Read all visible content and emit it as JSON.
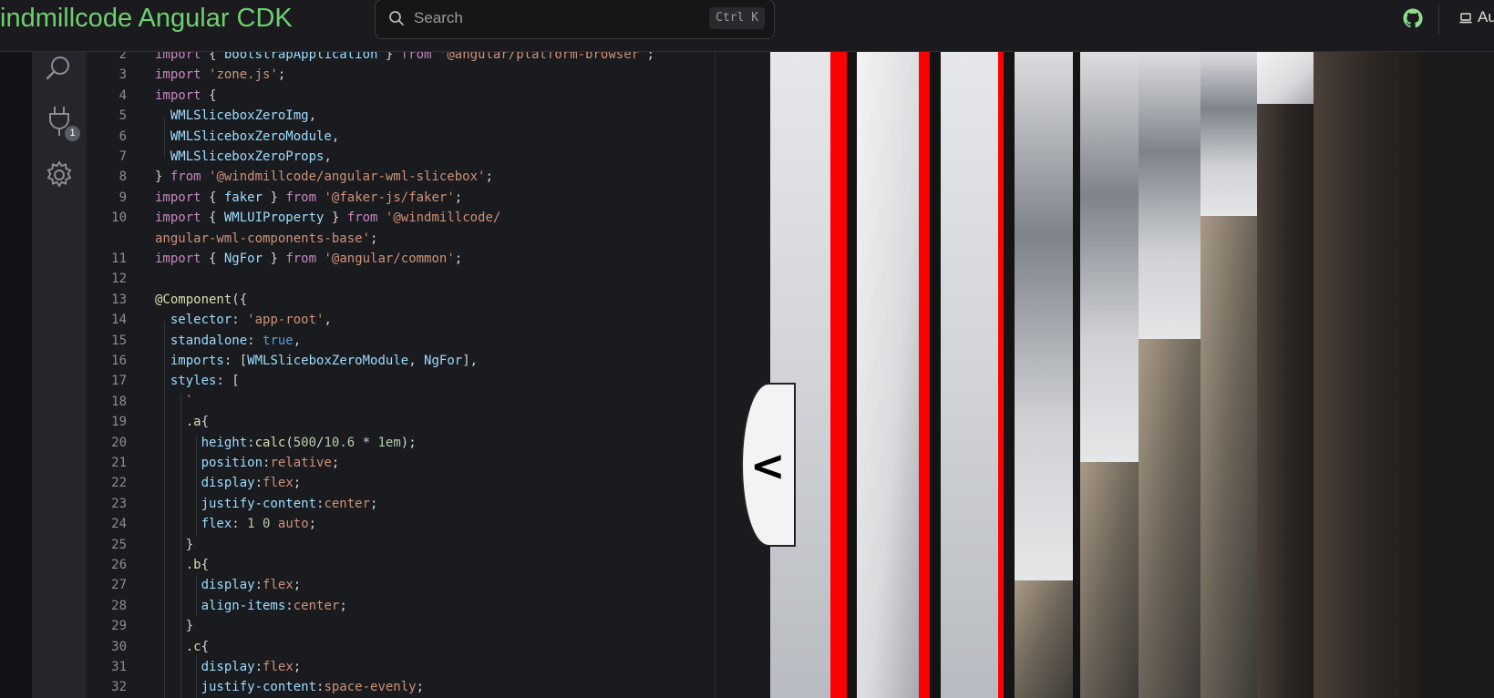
{
  "header": {
    "brand": "indmillcode Angular CDK",
    "search_placeholder": "Search",
    "search_shortcut": "Ctrl K",
    "auth_label": "Au"
  },
  "activity_bar": {
    "extensions_badge": "1",
    "icons": [
      "search-icon",
      "plug-icon",
      "gear-icon"
    ]
  },
  "colors": {
    "brand": "#6fcf6f",
    "keyword": "#c586c0",
    "string": "#ce9178",
    "identifier": "#9cdcfe",
    "function": "#dcdcaa",
    "number": "#b5cea8",
    "boolean": "#569cd6",
    "red_strip": "#ff0000"
  },
  "code": {
    "lines": [
      {
        "n": "2",
        "tokens": [
          [
            "kw",
            "import"
          ],
          [
            "pun",
            " { "
          ],
          [
            "id",
            "bootstrapApplication"
          ],
          [
            "pun",
            " } "
          ],
          [
            "kw",
            "from"
          ],
          [
            "pun",
            " "
          ],
          [
            "str",
            "'@angular/platform-browser'"
          ],
          [
            "pun",
            ";"
          ]
        ]
      },
      {
        "n": "3",
        "tokens": [
          [
            "kw",
            "import"
          ],
          [
            "pun",
            " "
          ],
          [
            "str",
            "'zone.js'"
          ],
          [
            "pun",
            ";"
          ]
        ]
      },
      {
        "n": "4",
        "tokens": [
          [
            "kw",
            "import"
          ],
          [
            "pun",
            " {"
          ]
        ]
      },
      {
        "n": "5",
        "tokens": [
          [
            "pun",
            "  "
          ],
          [
            "id",
            "WMLSliceboxZeroImg"
          ],
          [
            "pun",
            ","
          ]
        ]
      },
      {
        "n": "6",
        "tokens": [
          [
            "pun",
            "  "
          ],
          [
            "id",
            "WMLSliceboxZeroModule"
          ],
          [
            "pun",
            ","
          ]
        ]
      },
      {
        "n": "7",
        "tokens": [
          [
            "pun",
            "  "
          ],
          [
            "id",
            "WMLSliceboxZeroProps"
          ],
          [
            "pun",
            ","
          ]
        ]
      },
      {
        "n": "8",
        "tokens": [
          [
            "pun",
            "} "
          ],
          [
            "kw",
            "from"
          ],
          [
            "pun",
            " "
          ],
          [
            "str",
            "'@windmillcode/angular-wml-slicebox'"
          ],
          [
            "pun",
            ";"
          ]
        ]
      },
      {
        "n": "9",
        "tokens": [
          [
            "kw",
            "import"
          ],
          [
            "pun",
            " { "
          ],
          [
            "id",
            "faker"
          ],
          [
            "pun",
            " } "
          ],
          [
            "kw",
            "from"
          ],
          [
            "pun",
            " "
          ],
          [
            "str",
            "'@faker-js/faker'"
          ],
          [
            "pun",
            ";"
          ]
        ]
      },
      {
        "n": "10",
        "tokens": [
          [
            "kw",
            "import"
          ],
          [
            "pun",
            " { "
          ],
          [
            "id",
            "WMLUIProperty"
          ],
          [
            "pun",
            " } "
          ],
          [
            "kw",
            "from"
          ],
          [
            "pun",
            " "
          ],
          [
            "str",
            "'@windmillcode/"
          ]
        ]
      },
      {
        "n": "",
        "tokens": [
          [
            "str",
            "angular-wml-components-base'"
          ],
          [
            "pun",
            ";"
          ]
        ]
      },
      {
        "n": "11",
        "tokens": [
          [
            "kw",
            "import"
          ],
          [
            "pun",
            " { "
          ],
          [
            "id",
            "NgFor"
          ],
          [
            "pun",
            " } "
          ],
          [
            "kw",
            "from"
          ],
          [
            "pun",
            " "
          ],
          [
            "str",
            "'@angular/common'"
          ],
          [
            "pun",
            ";"
          ]
        ]
      },
      {
        "n": "12",
        "tokens": []
      },
      {
        "n": "13",
        "tokens": [
          [
            "fn",
            "@Component"
          ],
          [
            "pun",
            "({"
          ]
        ]
      },
      {
        "n": "14",
        "tokens": [
          [
            "pun",
            "  "
          ],
          [
            "id",
            "selector"
          ],
          [
            "pun",
            ": "
          ],
          [
            "str",
            "'app-root'"
          ],
          [
            "pun",
            ","
          ]
        ]
      },
      {
        "n": "15",
        "tokens": [
          [
            "pun",
            "  "
          ],
          [
            "id",
            "standalone"
          ],
          [
            "pun",
            ": "
          ],
          [
            "bool",
            "true"
          ],
          [
            "pun",
            ","
          ]
        ]
      },
      {
        "n": "16",
        "tokens": [
          [
            "pun",
            "  "
          ],
          [
            "id",
            "imports"
          ],
          [
            "pun",
            ": ["
          ],
          [
            "id",
            "WMLSliceboxZeroModule"
          ],
          [
            "pun",
            ", "
          ],
          [
            "id",
            "NgFor"
          ],
          [
            "pun",
            "],"
          ]
        ]
      },
      {
        "n": "17",
        "tokens": [
          [
            "pun",
            "  "
          ],
          [
            "id",
            "styles"
          ],
          [
            "pun",
            ": ["
          ]
        ]
      },
      {
        "n": "18",
        "tokens": [
          [
            "str",
            "    `"
          ]
        ]
      },
      {
        "n": "19",
        "tokens": [
          [
            "fn",
            "    .a"
          ],
          [
            "pun",
            "{"
          ]
        ]
      },
      {
        "n": "20",
        "tokens": [
          [
            "pun",
            "      "
          ],
          [
            "id",
            "height"
          ],
          [
            "pun",
            ":"
          ],
          [
            "fn",
            "calc"
          ],
          [
            "pun",
            "("
          ],
          [
            "num",
            "500"
          ],
          [
            "pun",
            "/"
          ],
          [
            "num",
            "10.6"
          ],
          [
            "pun",
            " * "
          ],
          [
            "num",
            "1em"
          ],
          [
            "pun",
            ");"
          ]
        ]
      },
      {
        "n": "21",
        "tokens": [
          [
            "pun",
            "      "
          ],
          [
            "id",
            "position"
          ],
          [
            "pun",
            ":"
          ],
          [
            "str",
            "relative"
          ],
          [
            "pun",
            ";"
          ]
        ]
      },
      {
        "n": "22",
        "tokens": [
          [
            "pun",
            "      "
          ],
          [
            "id",
            "display"
          ],
          [
            "pun",
            ":"
          ],
          [
            "str",
            "flex"
          ],
          [
            "pun",
            ";"
          ]
        ]
      },
      {
        "n": "23",
        "tokens": [
          [
            "pun",
            "      "
          ],
          [
            "id",
            "justify-content"
          ],
          [
            "pun",
            ":"
          ],
          [
            "str",
            "center"
          ],
          [
            "pun",
            ";"
          ]
        ]
      },
      {
        "n": "24",
        "tokens": [
          [
            "pun",
            "      "
          ],
          [
            "id",
            "flex"
          ],
          [
            "pun",
            ": "
          ],
          [
            "num",
            "1"
          ],
          [
            "pun",
            " "
          ],
          [
            "num",
            "0"
          ],
          [
            "pun",
            " "
          ],
          [
            "str",
            "auto"
          ],
          [
            "pun",
            ";"
          ]
        ]
      },
      {
        "n": "25",
        "tokens": [
          [
            "pun",
            "    }"
          ]
        ]
      },
      {
        "n": "26",
        "tokens": [
          [
            "fn",
            "    .b"
          ],
          [
            "pun",
            "{"
          ]
        ]
      },
      {
        "n": "27",
        "tokens": [
          [
            "pun",
            "      "
          ],
          [
            "id",
            "display"
          ],
          [
            "pun",
            ":"
          ],
          [
            "str",
            "flex"
          ],
          [
            "pun",
            ";"
          ]
        ]
      },
      {
        "n": "28",
        "tokens": [
          [
            "pun",
            "      "
          ],
          [
            "id",
            "align-items"
          ],
          [
            "pun",
            ":"
          ],
          [
            "str",
            "center"
          ],
          [
            "pun",
            ";"
          ]
        ]
      },
      {
        "n": "29",
        "tokens": [
          [
            "pun",
            "    }"
          ]
        ]
      },
      {
        "n": "30",
        "tokens": [
          [
            "fn",
            "    .c"
          ],
          [
            "pun",
            "{"
          ]
        ]
      },
      {
        "n": "31",
        "tokens": [
          [
            "pun",
            "      "
          ],
          [
            "id",
            "display"
          ],
          [
            "pun",
            ":"
          ],
          [
            "str",
            "flex"
          ],
          [
            "pun",
            ";"
          ]
        ]
      },
      {
        "n": "32",
        "tokens": [
          [
            "pun",
            "      "
          ],
          [
            "id",
            "justify-content"
          ],
          [
            "pun",
            ":"
          ],
          [
            "str",
            "space-evenly"
          ],
          [
            "pun",
            ";"
          ]
        ]
      }
    ]
  },
  "preview": {
    "prev_button_glyph": "<"
  }
}
